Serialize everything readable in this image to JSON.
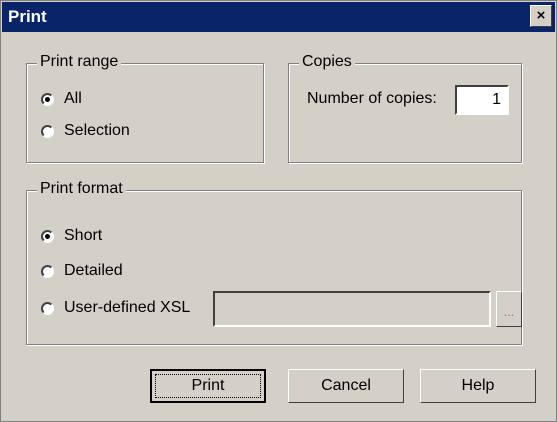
{
  "window": {
    "title": "Print",
    "close_glyph": "×"
  },
  "print_range": {
    "legend": "Print range",
    "options": [
      {
        "label": "All",
        "checked": true
      },
      {
        "label": "Selection",
        "checked": false
      }
    ]
  },
  "copies": {
    "legend": "Copies",
    "label": "Number of copies:",
    "value": "1"
  },
  "print_format": {
    "legend": "Print format",
    "options": [
      {
        "label": "Short",
        "checked": true
      },
      {
        "label": "Detailed",
        "checked": false
      },
      {
        "label": "User-defined XSL",
        "checked": false
      }
    ],
    "xsl_path": "",
    "browse_label": "..."
  },
  "buttons": {
    "print": "Print",
    "cancel": "Cancel",
    "help": "Help"
  }
}
